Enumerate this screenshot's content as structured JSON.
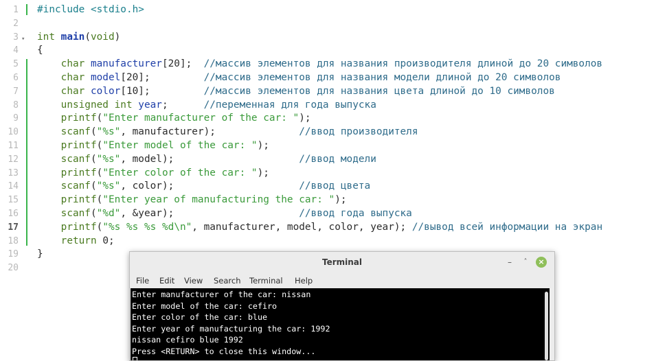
{
  "editor": {
    "line_numbers": [
      "1",
      "2",
      "3",
      "4",
      "5",
      "6",
      "7",
      "8",
      "9",
      "10",
      "11",
      "12",
      "13",
      "14",
      "15",
      "16",
      "17",
      "18",
      "19",
      "20"
    ],
    "current_line": "17",
    "lines": [
      [
        {
          "c": "pp",
          "t": "#include <stdio.h>"
        }
      ],
      [],
      [
        {
          "c": "ty",
          "t": "int "
        },
        {
          "c": "fn",
          "t": "main"
        },
        {
          "c": "",
          "t": "("
        },
        {
          "c": "ty",
          "t": "void"
        },
        {
          "c": "",
          "t": ")"
        }
      ],
      [
        {
          "c": "",
          "t": "{"
        }
      ],
      [
        {
          "c": "ty",
          "t": "    char "
        },
        {
          "c": "var",
          "t": "manufacturer"
        },
        {
          "c": "",
          "t": "[20];  "
        },
        {
          "c": "cm",
          "t": "//массив элементов для названия производителя длиной до 20 символов"
        }
      ],
      [
        {
          "c": "ty",
          "t": "    char "
        },
        {
          "c": "var",
          "t": "model"
        },
        {
          "c": "",
          "t": "[20];         "
        },
        {
          "c": "cm",
          "t": "//массив элементов для названия модели длиной до 20 символов"
        }
      ],
      [
        {
          "c": "ty",
          "t": "    char "
        },
        {
          "c": "var",
          "t": "color"
        },
        {
          "c": "",
          "t": "[10];         "
        },
        {
          "c": "cm",
          "t": "//массив элементов для названия цвета длиной до 10 символов"
        }
      ],
      [
        {
          "c": "ty",
          "t": "    unsigned int "
        },
        {
          "c": "var",
          "t": "year"
        },
        {
          "c": "",
          "t": ";      "
        },
        {
          "c": "cm",
          "t": "//переменная для года выпуска"
        }
      ],
      [
        {
          "c": "kw",
          "t": "    printf"
        },
        {
          "c": "",
          "t": "("
        },
        {
          "c": "str",
          "t": "\"Enter manufacturer of the car: \""
        },
        {
          "c": "",
          "t": ");"
        }
      ],
      [
        {
          "c": "kw",
          "t": "    scanf"
        },
        {
          "c": "",
          "t": "("
        },
        {
          "c": "str",
          "t": "\"%s\""
        },
        {
          "c": "",
          "t": ", manufacturer);              "
        },
        {
          "c": "cm",
          "t": "//ввод производителя"
        }
      ],
      [
        {
          "c": "kw",
          "t": "    printf"
        },
        {
          "c": "",
          "t": "("
        },
        {
          "c": "str",
          "t": "\"Enter model of the car: \""
        },
        {
          "c": "",
          "t": ");"
        }
      ],
      [
        {
          "c": "kw",
          "t": "    scanf"
        },
        {
          "c": "",
          "t": "("
        },
        {
          "c": "str",
          "t": "\"%s\""
        },
        {
          "c": "",
          "t": ", model);                     "
        },
        {
          "c": "cm",
          "t": "//ввод модели"
        }
      ],
      [
        {
          "c": "kw",
          "t": "    printf"
        },
        {
          "c": "",
          "t": "("
        },
        {
          "c": "str",
          "t": "\"Enter color of the car: \""
        },
        {
          "c": "",
          "t": ");"
        }
      ],
      [
        {
          "c": "kw",
          "t": "    scanf"
        },
        {
          "c": "",
          "t": "("
        },
        {
          "c": "str",
          "t": "\"%s\""
        },
        {
          "c": "",
          "t": ", color);                     "
        },
        {
          "c": "cm",
          "t": "//ввод цвета"
        }
      ],
      [
        {
          "c": "kw",
          "t": "    printf"
        },
        {
          "c": "",
          "t": "("
        },
        {
          "c": "str",
          "t": "\"Enter year of manufacturing the car: \""
        },
        {
          "c": "",
          "t": ");"
        }
      ],
      [
        {
          "c": "kw",
          "t": "    scanf"
        },
        {
          "c": "",
          "t": "("
        },
        {
          "c": "str",
          "t": "\"%d\""
        },
        {
          "c": "",
          "t": ", &year);                     "
        },
        {
          "c": "cm",
          "t": "//ввод года выпуска"
        }
      ],
      [
        {
          "c": "kw",
          "t": "    printf"
        },
        {
          "c": "",
          "t": "("
        },
        {
          "c": "str",
          "t": "\"%s %s %s %d\\n\""
        },
        {
          "c": "",
          "t": ", manufacturer, model, color, year); "
        },
        {
          "c": "cm",
          "t": "//вывод всей информации на экран"
        }
      ],
      [
        {
          "c": "kw",
          "t": "    return "
        },
        {
          "c": "num",
          "t": "0;"
        }
      ],
      [
        {
          "c": "",
          "t": "}"
        }
      ],
      []
    ]
  },
  "terminal": {
    "title": "Terminal",
    "minimize_glyph": "–",
    "maximize_glyph": "˄",
    "close_glyph": "×",
    "menu": [
      "File",
      "Edit",
      "View",
      "Search",
      "Terminal",
      "Help"
    ],
    "output": [
      "Enter manufacturer of the car: nissan",
      "Enter model of the car: cefiro",
      "Enter color of the car: blue",
      "Enter year of manufacturing the car: 1992",
      "nissan cefiro blue 1992",
      "Press <RETURN> to close this window..."
    ]
  }
}
